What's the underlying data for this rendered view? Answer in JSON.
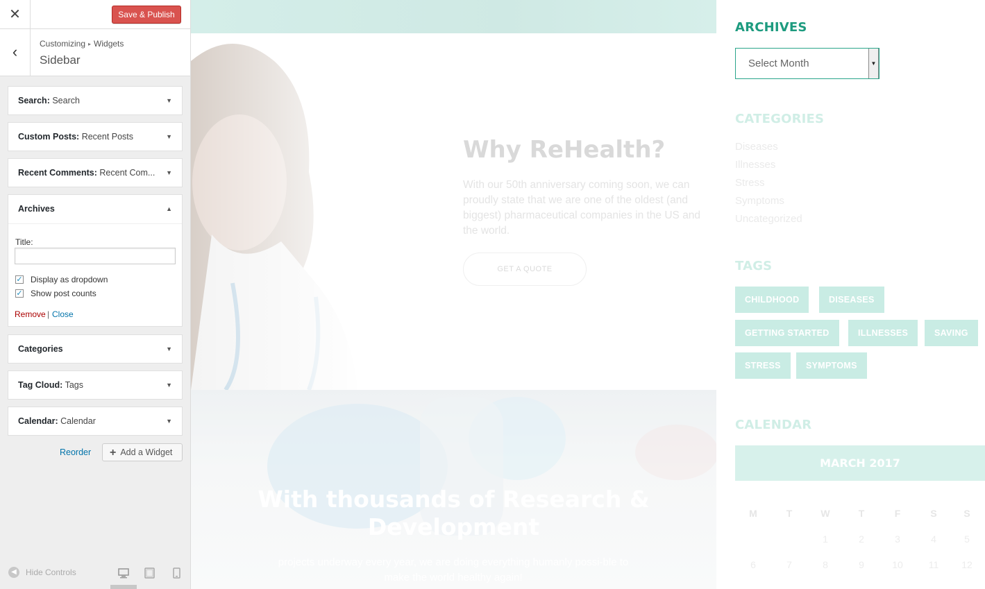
{
  "customizer": {
    "save_publish": "Save & Publish",
    "breadcrumb": {
      "root": "Customizing",
      "section": "Widgets"
    },
    "section_title": "Sidebar",
    "widgets": [
      {
        "name": "Search:",
        "subtitle": "Search"
      },
      {
        "name": "Custom Posts:",
        "subtitle": "Recent Posts"
      },
      {
        "name": "Recent Comments:",
        "subtitle": "Recent Com..."
      },
      {
        "name": "Archives",
        "subtitle": ""
      },
      {
        "name": "Categories",
        "subtitle": ""
      },
      {
        "name": "Tag Cloud:",
        "subtitle": "Tags"
      },
      {
        "name": "Calendar:",
        "subtitle": "Calendar"
      }
    ],
    "archives_form": {
      "title_label": "Title:",
      "title_value": "",
      "display_as_dropdown": {
        "label": "Display as dropdown",
        "checked": true
      },
      "show_post_counts": {
        "label": "Show post counts",
        "checked": true
      },
      "remove_label": "Remove",
      "separator": "|",
      "close_label": "Close"
    },
    "reorder_label": "Reorder",
    "add_widget_label": "Add a Widget",
    "hide_controls_label": "Hide Controls",
    "icons": [
      "close-icon",
      "back-arrow-icon",
      "plus-icon",
      "desktop-icon",
      "tablet-icon",
      "mobile-icon"
    ]
  },
  "preview": {
    "hero": {
      "heading": "Why ReHealth?",
      "text": "With our 50th anniversary coming soon, we can proudly state that we are one of the oldest (and biggest) pharmaceutical companies in the US and the world.",
      "button": "GET A QUOTE"
    },
    "lab": {
      "heading": "With thousands of Research & Development",
      "text": "projects underway every year, we are doing everything humanly possi-ble to make the world healthy again!"
    },
    "sidebar": {
      "archives_title": "ARCHIVES",
      "archives_select": "Select Month",
      "categories_title": "CATEGORIES",
      "categories": [
        "Diseases",
        "Illnesses",
        "Stress",
        "Symptoms",
        "Uncategorized"
      ],
      "tags_title": "TAGS",
      "tags": [
        "CHILDHOOD",
        "DISEASES",
        "GETTING STARTED",
        "ILLNESSES",
        "SAVING",
        "STRESS",
        "SYMPTOMS"
      ],
      "calendar_title": "CALENDAR",
      "calendar_month": "MARCH 2017",
      "calendar_days": [
        "M",
        "T",
        "W",
        "T",
        "F",
        "S",
        "S"
      ],
      "calendar_row1": [
        "1",
        "2",
        "3",
        "4",
        "5"
      ],
      "calendar_row2": [
        "6",
        "7",
        "8",
        "9",
        "10",
        "11",
        "12"
      ]
    },
    "colors": {
      "accent": "#1d9b7f",
      "publish": "#d9534f",
      "link": "#0073aa",
      "remove": "#aa0000"
    }
  }
}
